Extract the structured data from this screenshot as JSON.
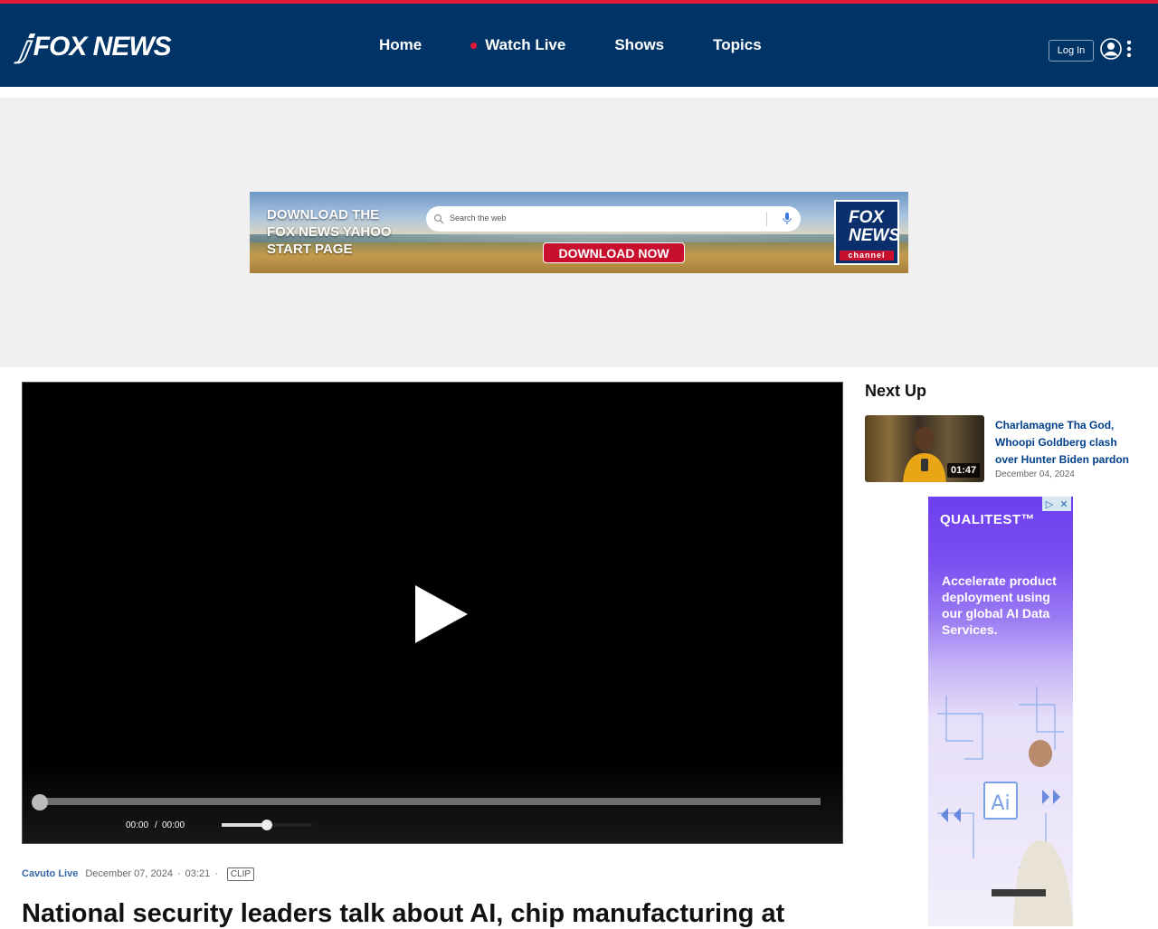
{
  "header": {
    "logo_text": "FOX NEWS",
    "nav": [
      "Home",
      "Watch Live",
      "Shows",
      "Topics"
    ],
    "login_label": "Log In"
  },
  "ad_banner": {
    "headline_line1": "DOWNLOAD THE",
    "headline_line2": "FOX NEWS YAHOO",
    "headline_line3": "START PAGE",
    "search_placeholder": "Search the web",
    "cta": "DOWNLOAD NOW",
    "logo_top": "FOX",
    "logo_bottom": "NEWS",
    "logo_channel": "channel"
  },
  "player": {
    "current_time": "00:00",
    "separator": "/",
    "duration": "00:00",
    "volume": 0.5,
    "progress": 0
  },
  "video_meta": {
    "show": "Cavuto Live",
    "date": "December 07, 2024",
    "dot": "·",
    "length": "03:21",
    "badge": "CLIP"
  },
  "headline": "National security leaders talk about AI, chip manufacturing at",
  "next_up": {
    "title": "Next Up",
    "item": {
      "title": "Charlamagne Tha God, Whoopi Goldberg clash over Hunter Biden pardon",
      "date": "December 04, 2024",
      "duration": "01:47"
    }
  },
  "side_ad": {
    "brand": "QUALITEST™",
    "copy": "Accelerate product deployment using our global AI Data Services.",
    "tag": "Ai"
  },
  "colors": {
    "header_bg": "#003366",
    "accent_red": "#e31937",
    "link_blue": "#003f8a"
  }
}
